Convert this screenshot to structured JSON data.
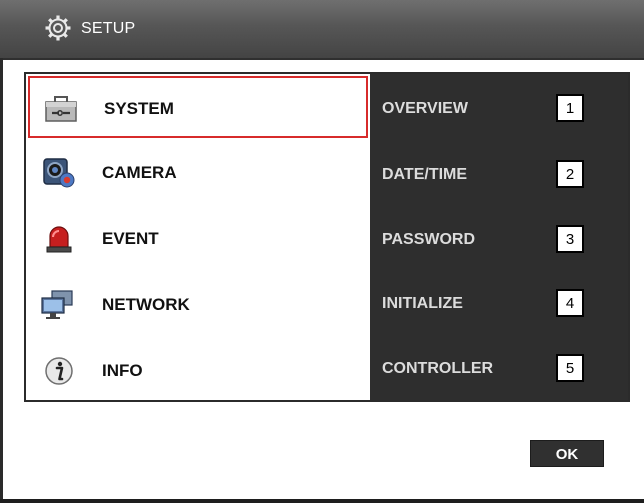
{
  "titlebar": {
    "title": "SETUP",
    "icon": "gear-icon"
  },
  "menu": {
    "items": [
      {
        "label": "SYSTEM",
        "icon": "toolbox-icon",
        "selected": true
      },
      {
        "label": "CAMERA",
        "icon": "camera-icon",
        "selected": false
      },
      {
        "label": "EVENT",
        "icon": "alarm-light-icon",
        "selected": false
      },
      {
        "label": "NETWORK",
        "icon": "network-monitors-icon",
        "selected": false
      },
      {
        "label": "INFO",
        "icon": "info-icon",
        "selected": false
      }
    ]
  },
  "submenu": {
    "items": [
      {
        "label": "OVERVIEW",
        "badge": "1"
      },
      {
        "label": "DATE/TIME",
        "badge": "2"
      },
      {
        "label": "PASSWORD",
        "badge": "3"
      },
      {
        "label": "INITIALIZE",
        "badge": "4"
      },
      {
        "label": "CONTROLLER",
        "badge": "5"
      }
    ]
  },
  "footer": {
    "ok_label": "OK"
  },
  "colors": {
    "titlebar": "#555555",
    "submenu_bg": "#2e2e2e",
    "selection_border": "#d72b2b",
    "submenu_text": "#dcdcdc"
  }
}
